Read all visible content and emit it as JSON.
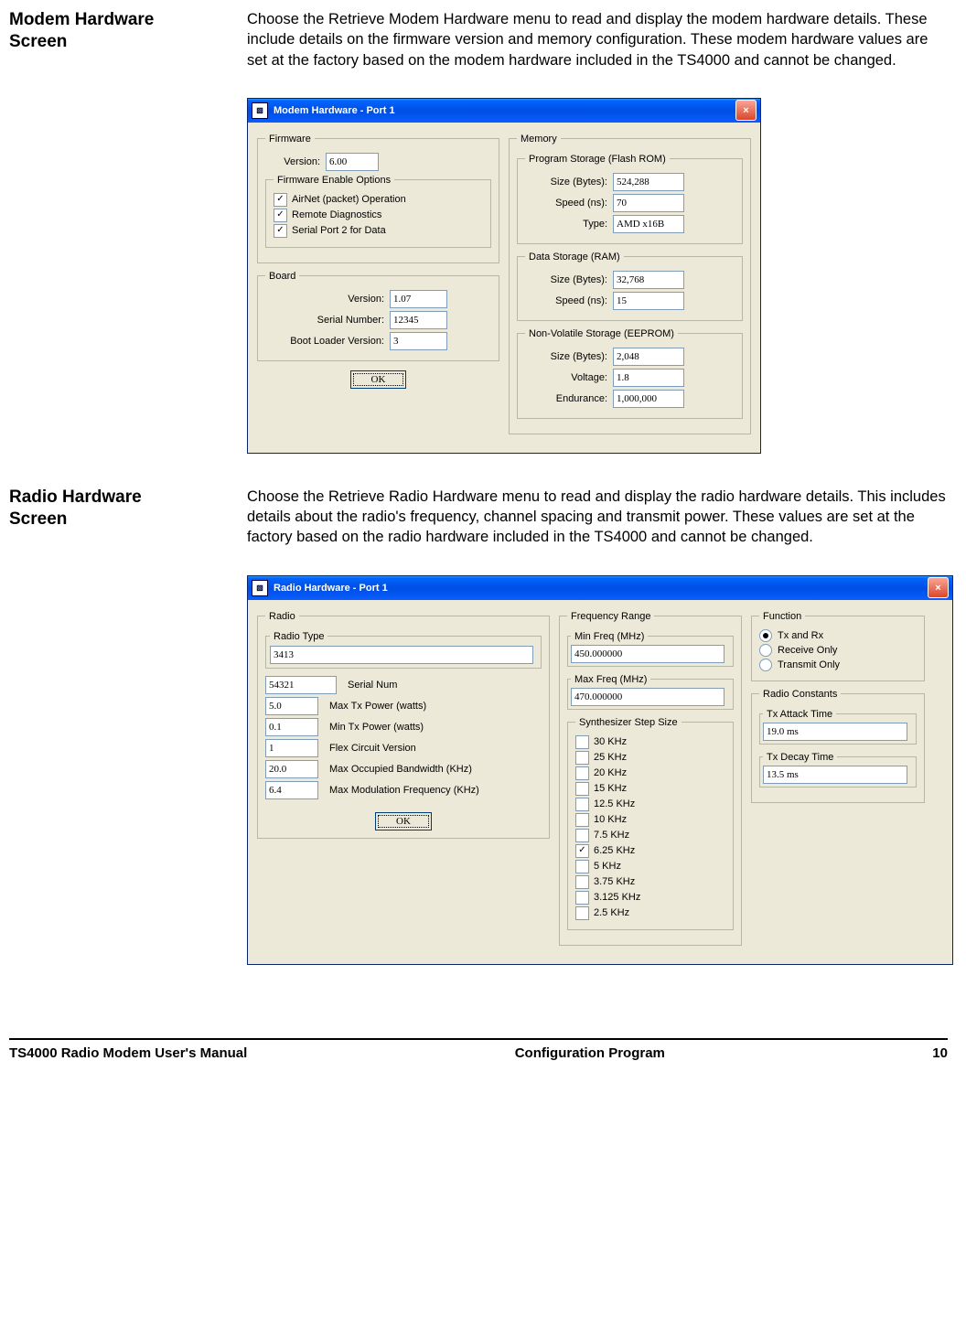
{
  "sections": {
    "modem": {
      "heading_line1": "Modem Hardware",
      "heading_line2": "Screen",
      "text": "Choose the Retrieve Modem Hardware menu to read and display the modem hardware details.  These include details on the firmware version and memory configuration.  These modem hardware values are set at the factory based on the modem hardware included in the TS4000 and cannot be changed."
    },
    "radio": {
      "heading_line1": "Radio Hardware",
      "heading_line2": "Screen",
      "text": "Choose the Retrieve Radio Hardware menu to read and display the radio hardware details.  This includes details about the radio's frequency, channel spacing and transmit power.  These values are set at the factory based on the radio hardware included in the TS4000 and cannot be changed."
    }
  },
  "modem_dialog": {
    "title": "Modem Hardware - Port  1",
    "firmware": {
      "legend": "Firmware",
      "version_label": "Version:",
      "version_value": "6.00",
      "enable_legend": "Firmware Enable Options",
      "opt_airnet": "AirNet (packet) Operation",
      "opt_remote": "Remote Diagnostics",
      "opt_serial": "Serial Port 2 for Data"
    },
    "board": {
      "legend": "Board",
      "version_label": "Version:",
      "version_value": "1.07",
      "serial_label": "Serial Number:",
      "serial_value": "12345",
      "boot_label": "Boot Loader Version:",
      "boot_value": "3"
    },
    "memory": {
      "legend": "Memory",
      "flash": {
        "legend": "Program Storage (Flash ROM)",
        "size_label": "Size (Bytes):",
        "size_value": "524,288",
        "speed_label": "Speed (ns):",
        "speed_value": "70",
        "type_label": "Type:",
        "type_value": "AMD x16B"
      },
      "ram": {
        "legend": "Data Storage (RAM)",
        "size_label": "Size (Bytes):",
        "size_value": "32,768",
        "speed_label": "Speed (ns):",
        "speed_value": "15"
      },
      "eeprom": {
        "legend": "Non-Volatile Storage (EEPROM)",
        "size_label": "Size (Bytes):",
        "size_value": "2,048",
        "volt_label": "Voltage:",
        "volt_value": "1.8",
        "end_label": "Endurance:",
        "end_value": "1,000,000"
      }
    },
    "ok": "OK"
  },
  "radio_dialog": {
    "title": "Radio Hardware - Port  1",
    "radio": {
      "legend": "Radio",
      "type_legend": "Radio Type",
      "type_value": "3413",
      "serial_value": "54321",
      "serial_label": "Serial Num",
      "maxtx_value": "5.0",
      "maxtx_label": "Max Tx Power (watts)",
      "mintx_value": "0.1",
      "mintx_label": "Min Tx Power (watts)",
      "flex_value": "1",
      "flex_label": "Flex Circuit Version",
      "occbw_value": "20.0",
      "occbw_label": "Max Occupied Bandwidth (KHz)",
      "mod_value": "6.4",
      "mod_label": "Max Modulation Frequency (KHz)"
    },
    "freq": {
      "legend": "Frequency Range",
      "min_legend": "Min Freq (MHz)",
      "min_value": "450.000000",
      "max_legend": "Max Freq (MHz)",
      "max_value": "470.000000",
      "step_legend": "Synthesizer Step Size",
      "steps": [
        "30 KHz",
        "25 KHz",
        "20 KHz",
        "15 KHz",
        "12.5 KHz",
        "10 KHz",
        "7.5 KHz",
        "6.25 KHz",
        "5 KHz",
        "3.75 KHz",
        "3.125 KHz",
        "2.5 KHz"
      ],
      "checked_index": 7
    },
    "function": {
      "legend": "Function",
      "opt_txrx": "Tx and Rx",
      "opt_rx": "Receive Only",
      "opt_tx": "Transmit Only"
    },
    "constants": {
      "legend": "Radio Constants",
      "attack_legend": "Tx Attack Time",
      "attack_value": "19.0 ms",
      "decay_legend": "Tx Decay Time",
      "decay_value": "13.5 ms"
    },
    "ok": "OK"
  },
  "footer": {
    "left": "TS4000 Radio Modem User's Manual",
    "center": "Configuration Program",
    "right": "10"
  }
}
